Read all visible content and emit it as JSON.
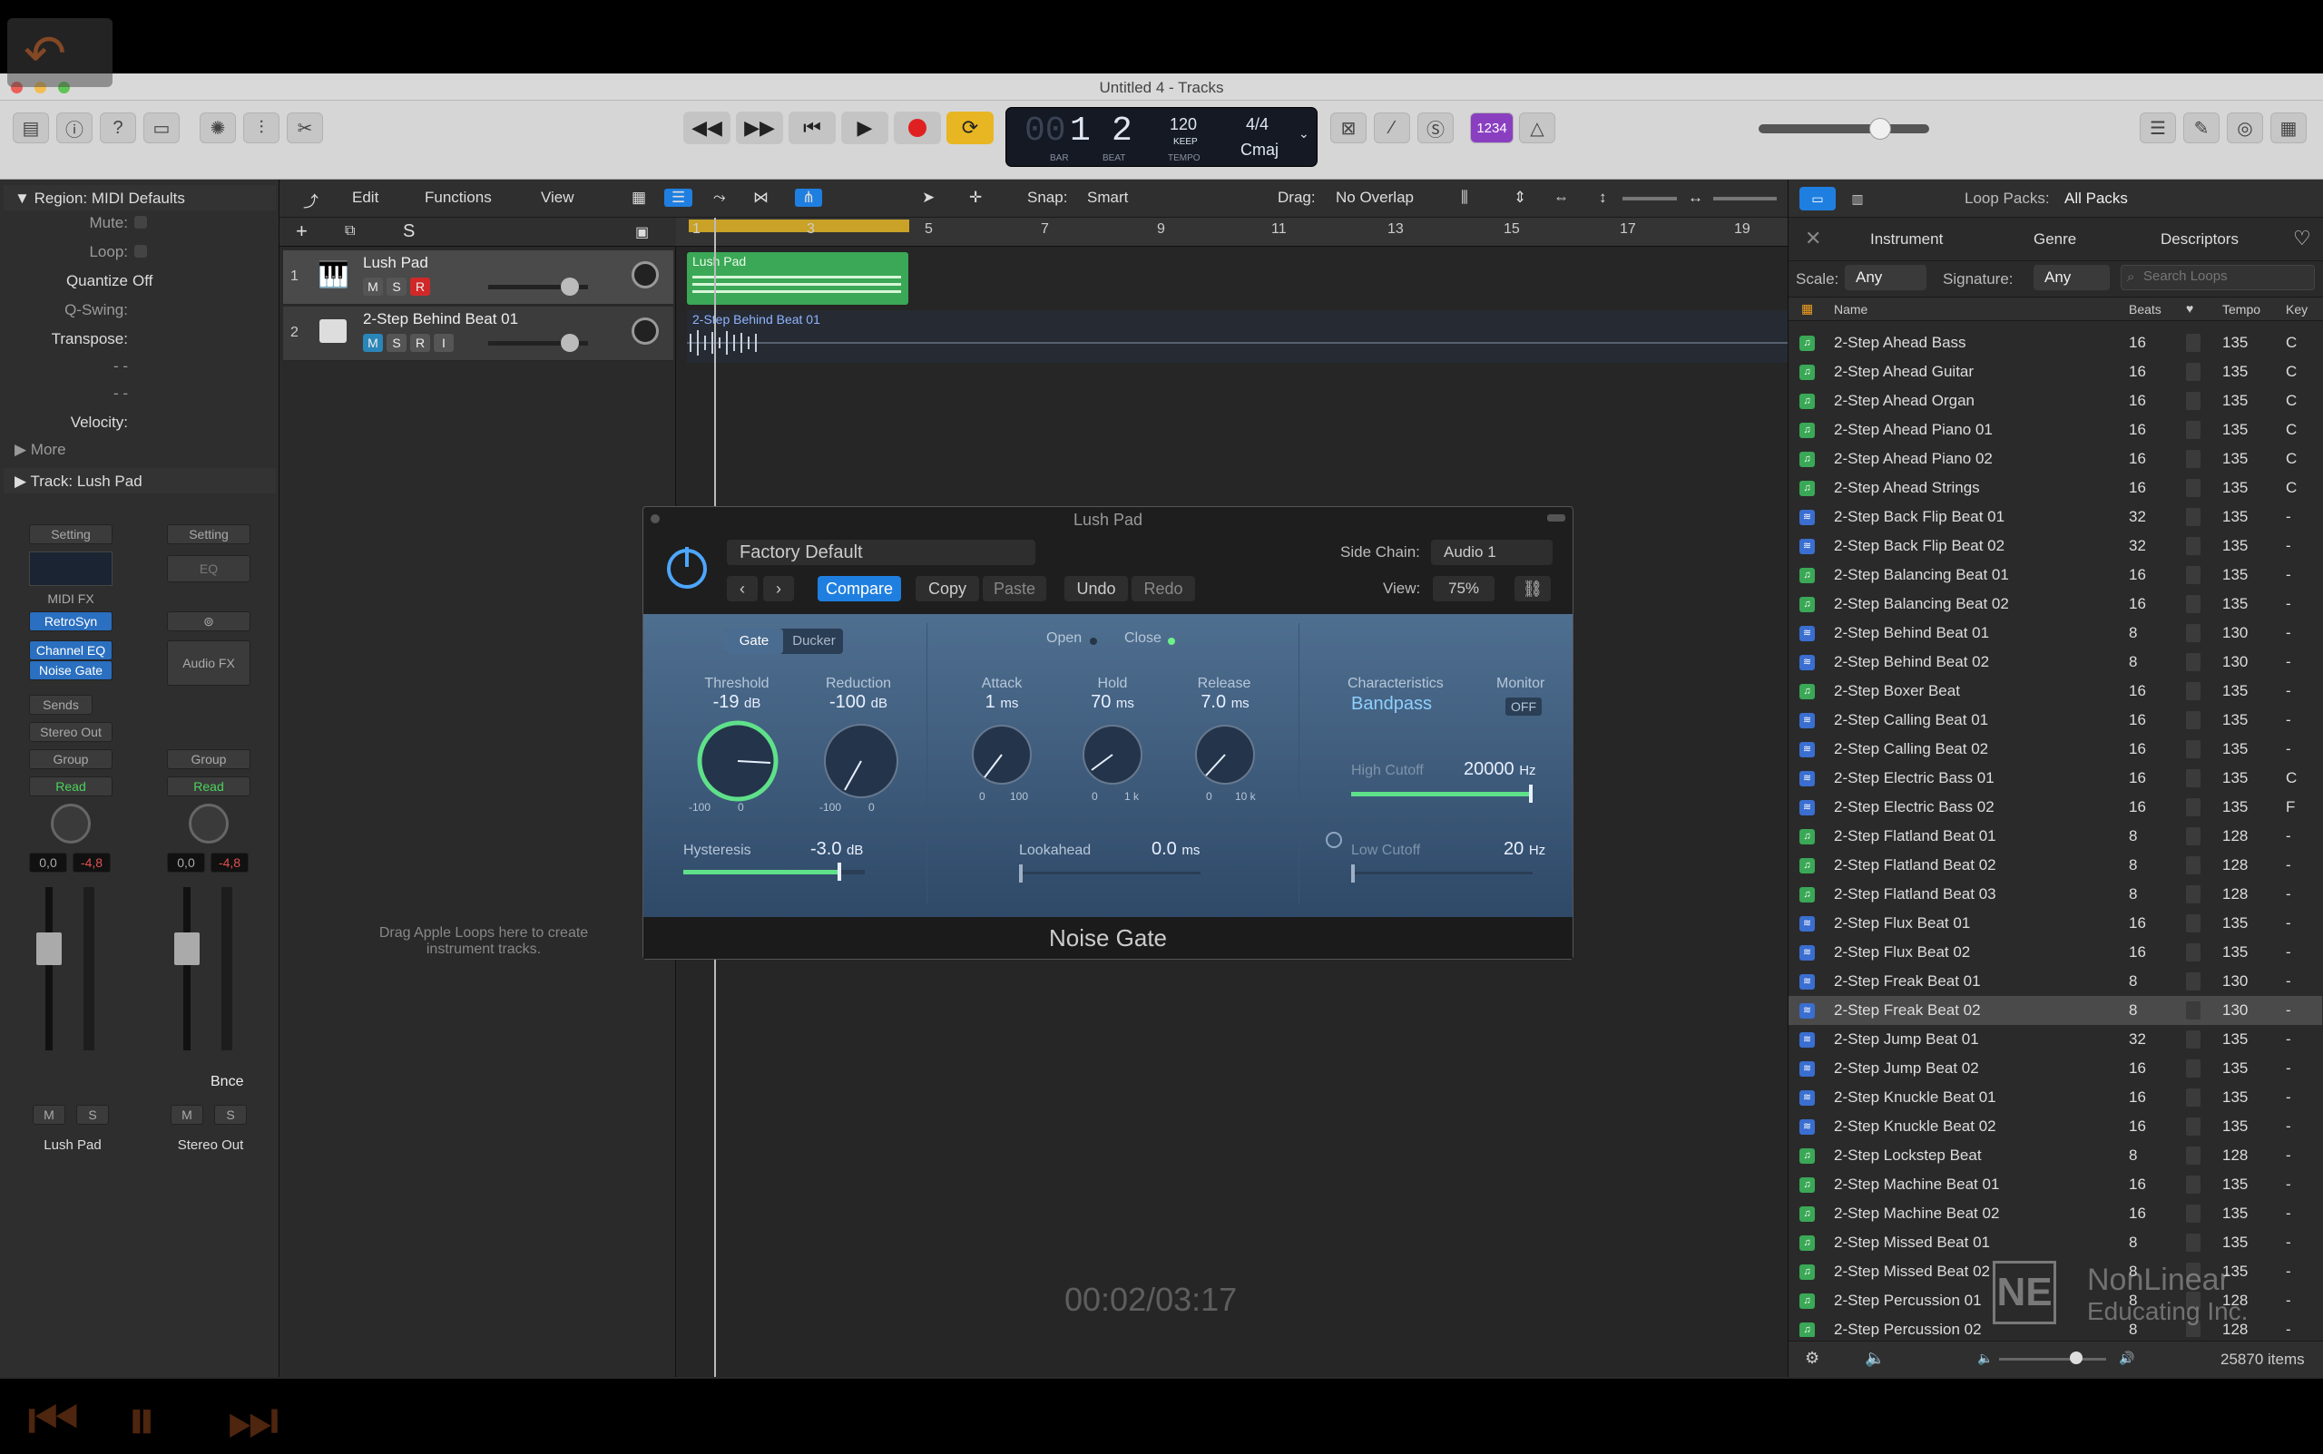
{
  "window": {
    "title": "Untitled 4 - Tracks"
  },
  "colors": {
    "accent": "#1f7fe0",
    "record": "#e02020",
    "region_green": "#3aa856",
    "plugin_blue": "#3c5a7c",
    "tuner_purple": "#8a3fc1"
  },
  "toolbar": {
    "lcd": {
      "bar": "1",
      "beat": "2",
      "bar_label": "BAR",
      "beat_label": "BEAT",
      "tempo": "120",
      "tempo_keep": "KEEP",
      "tempo_label": "TEMPO",
      "signature": "4/4",
      "key": "Cmaj",
      "dim_digits": "00"
    },
    "count_in": "1234",
    "icons": [
      "library-icon",
      "info-icon",
      "help-icon",
      "toolbar-icon",
      "smart-controls-icon",
      "mixer-icon",
      "editors-icon",
      "rewind-icon",
      "forward-icon",
      "go-to-start-icon",
      "play-icon",
      "record-icon",
      "cycle-icon",
      "replace-icon",
      "autopunch-icon",
      "solo-icon",
      "metronome-icon",
      "list-editors-icon",
      "notepad-icon",
      "loop-browser-icon",
      "browsers-icon"
    ]
  },
  "inspector": {
    "region_header": "Region: MIDI Defaults",
    "mute_label": "Mute:",
    "loop_label": "Loop:",
    "quantize_label": "Quantize",
    "quantize_value": "Off",
    "qswing_label": "Q-Swing:",
    "transpose_label": "Transpose:",
    "dash1": "- -",
    "dash2": "- -",
    "velocity_label": "Velocity:",
    "more_label": "More",
    "track_header": "Track:",
    "track_name": "Lush Pad",
    "strip1": {
      "setting": "Setting",
      "midi_fx": "MIDI FX",
      "instrument": "RetroSyn",
      "fx1": "Channel EQ",
      "fx2": "Noise Gate",
      "sends": "Sends",
      "output": "Stereo Out",
      "group": "Group",
      "automation": "Read",
      "pan_val": "0,0",
      "level": "-4,8",
      "mute": "M",
      "solo": "S",
      "name": "Lush Pad"
    },
    "strip2": {
      "setting": "Setting",
      "eq": "EQ",
      "audio_fx": "Audio FX",
      "group": "Group",
      "automation": "Read",
      "pan_val": "0,0",
      "level": "-4,8",
      "bounce": "Bnce",
      "mute": "M",
      "solo": "S",
      "name": "Stereo Out"
    }
  },
  "tracks_bar": {
    "edit": "Edit",
    "functions": "Functions",
    "view": "View",
    "snap_label": "Snap:",
    "snap_value": "Smart",
    "drag_label": "Drag:",
    "drag_value": "No Overlap"
  },
  "track_list_header": {
    "add": "+",
    "solo": "S"
  },
  "tracks": [
    {
      "num": "1",
      "name": "Lush Pad",
      "m": "M",
      "s": "S",
      "r": "R"
    },
    {
      "num": "2",
      "name": "2-Step Behind Beat 01",
      "m": "M",
      "s": "S",
      "r": "R",
      "i": "I"
    }
  ],
  "drop_hint": "Drag Apple Loops here to create instrument tracks.",
  "ruler": [
    "1",
    "3",
    "5",
    "7",
    "9",
    "11",
    "13",
    "15",
    "17",
    "19"
  ],
  "regions": [
    {
      "name": "Lush Pad"
    },
    {
      "name": "2-Step Behind Beat 01"
    }
  ],
  "plugin": {
    "title": "Lush Pad",
    "preset": "Factory Default",
    "compare": "Compare",
    "copy": "Copy",
    "paste": "Paste",
    "undo": "Undo",
    "redo": "Redo",
    "sidechain_label": "Side Chain:",
    "sidechain_value": "Audio 1",
    "view_label": "View:",
    "view_value": "75%",
    "mode_gate": "Gate",
    "mode_ducker": "Ducker",
    "open": "Open",
    "close": "Close",
    "threshold_label": "Threshold",
    "threshold_value": "-19",
    "reduction_label": "Reduction",
    "reduction_value": "-100",
    "db": "dB",
    "scale_min": "-100",
    "scale_zero": "0",
    "attack_label": "Attack",
    "attack_value": "1",
    "attack_min": "0",
    "attack_max": "100",
    "hold_label": "Hold",
    "hold_value": "70",
    "hold_min": "0",
    "hold_max": "1 k",
    "release_label": "Release",
    "release_value": "7.0",
    "release_min": "0",
    "release_max": "10 k",
    "ms": "ms",
    "characteristics_label": "Characteristics",
    "characteristics_value": "Bandpass",
    "monitor_label": "Monitor",
    "monitor_value": "OFF",
    "high_cutoff_label": "High Cutoff",
    "high_cutoff_value": "20000",
    "low_cutoff_label": "Low Cutoff",
    "low_cutoff_value": "20",
    "hz": "Hz",
    "hysteresis_label": "Hysteresis",
    "hysteresis_value": "-3.0",
    "lookahead_label": "Lookahead",
    "lookahead_value": "0.0",
    "footer": "Noise Gate"
  },
  "overlay": {
    "time": "00:02/03:17",
    "brand1": "NonLinear",
    "brand2": "Educating Inc.",
    "logo": "NE"
  },
  "browser": {
    "loop_packs_label": "Loop Packs:",
    "loop_packs_value": "All Packs",
    "tabs": [
      "Instrument",
      "Genre",
      "Descriptors"
    ],
    "scale_label": "Scale:",
    "scale_value": "Any",
    "signature_label": "Signature:",
    "signature_value": "Any",
    "search_placeholder": "Search Loops",
    "columns": {
      "name": "Name",
      "beats": "Beats",
      "tempo": "Tempo",
      "key": "Key"
    },
    "items_count": "25870 items",
    "loops": [
      {
        "name": "2-Step Ahead Bass",
        "beats": "16",
        "tempo": "135",
        "key": "C",
        "type": "midi"
      },
      {
        "name": "2-Step Ahead Guitar",
        "beats": "16",
        "tempo": "135",
        "key": "C",
        "type": "midi"
      },
      {
        "name": "2-Step Ahead Organ",
        "beats": "16",
        "tempo": "135",
        "key": "C",
        "type": "midi"
      },
      {
        "name": "2-Step Ahead Piano 01",
        "beats": "16",
        "tempo": "135",
        "key": "C",
        "type": "midi"
      },
      {
        "name": "2-Step Ahead Piano 02",
        "beats": "16",
        "tempo": "135",
        "key": "C",
        "type": "midi"
      },
      {
        "name": "2-Step Ahead Strings",
        "beats": "16",
        "tempo": "135",
        "key": "C",
        "type": "midi"
      },
      {
        "name": "2-Step Back Flip Beat 01",
        "beats": "32",
        "tempo": "135",
        "key": "-",
        "type": "audio"
      },
      {
        "name": "2-Step Back Flip Beat 02",
        "beats": "32",
        "tempo": "135",
        "key": "-",
        "type": "audio"
      },
      {
        "name": "2-Step Balancing Beat 01",
        "beats": "16",
        "tempo": "135",
        "key": "-",
        "type": "midi"
      },
      {
        "name": "2-Step Balancing Beat 02",
        "beats": "16",
        "tempo": "135",
        "key": "-",
        "type": "midi"
      },
      {
        "name": "2-Step Behind Beat 01",
        "beats": "8",
        "tempo": "130",
        "key": "-",
        "type": "audio"
      },
      {
        "name": "2-Step Behind Beat 02",
        "beats": "8",
        "tempo": "130",
        "key": "-",
        "type": "audio"
      },
      {
        "name": "2-Step Boxer Beat",
        "beats": "16",
        "tempo": "135",
        "key": "-",
        "type": "midi"
      },
      {
        "name": "2-Step Calling Beat 01",
        "beats": "16",
        "tempo": "135",
        "key": "-",
        "type": "audio"
      },
      {
        "name": "2-Step Calling Beat 02",
        "beats": "16",
        "tempo": "135",
        "key": "-",
        "type": "audio"
      },
      {
        "name": "2-Step Electric Bass 01",
        "beats": "16",
        "tempo": "135",
        "key": "C",
        "type": "audio"
      },
      {
        "name": "2-Step Electric Bass 02",
        "beats": "16",
        "tempo": "135",
        "key": "F",
        "type": "audio"
      },
      {
        "name": "2-Step Flatland Beat 01",
        "beats": "8",
        "tempo": "128",
        "key": "-",
        "type": "midi"
      },
      {
        "name": "2-Step Flatland Beat 02",
        "beats": "8",
        "tempo": "128",
        "key": "-",
        "type": "midi"
      },
      {
        "name": "2-Step Flatland Beat 03",
        "beats": "8",
        "tempo": "128",
        "key": "-",
        "type": "midi"
      },
      {
        "name": "2-Step Flux Beat 01",
        "beats": "16",
        "tempo": "135",
        "key": "-",
        "type": "audio"
      },
      {
        "name": "2-Step Flux Beat 02",
        "beats": "16",
        "tempo": "135",
        "key": "-",
        "type": "audio"
      },
      {
        "name": "2-Step Freak Beat 01",
        "beats": "8",
        "tempo": "130",
        "key": "-",
        "type": "audio"
      },
      {
        "name": "2-Step Freak Beat 02",
        "beats": "8",
        "tempo": "130",
        "key": "-",
        "type": "audio",
        "selected": true
      },
      {
        "name": "2-Step Jump Beat 01",
        "beats": "32",
        "tempo": "135",
        "key": "-",
        "type": "audio"
      },
      {
        "name": "2-Step Jump Beat 02",
        "beats": "16",
        "tempo": "135",
        "key": "-",
        "type": "audio"
      },
      {
        "name": "2-Step Knuckle Beat 01",
        "beats": "16",
        "tempo": "135",
        "key": "-",
        "type": "audio"
      },
      {
        "name": "2-Step Knuckle Beat 02",
        "beats": "16",
        "tempo": "135",
        "key": "-",
        "type": "audio"
      },
      {
        "name": "2-Step Lockstep Beat",
        "beats": "8",
        "tempo": "128",
        "key": "-",
        "type": "midi"
      },
      {
        "name": "2-Step Machine Beat 01",
        "beats": "16",
        "tempo": "135",
        "key": "-",
        "type": "midi"
      },
      {
        "name": "2-Step Machine Beat 02",
        "beats": "16",
        "tempo": "135",
        "key": "-",
        "type": "midi"
      },
      {
        "name": "2-Step Missed Beat 01",
        "beats": "8",
        "tempo": "135",
        "key": "-",
        "type": "midi"
      },
      {
        "name": "2-Step Missed Beat 02",
        "beats": "8",
        "tempo": "135",
        "key": "-",
        "type": "midi"
      },
      {
        "name": "2-Step Percussion 01",
        "beats": "8",
        "tempo": "128",
        "key": "-",
        "type": "midi"
      },
      {
        "name": "2-Step Percussion 02",
        "beats": "8",
        "tempo": "128",
        "key": "-",
        "type": "midi"
      }
    ]
  }
}
